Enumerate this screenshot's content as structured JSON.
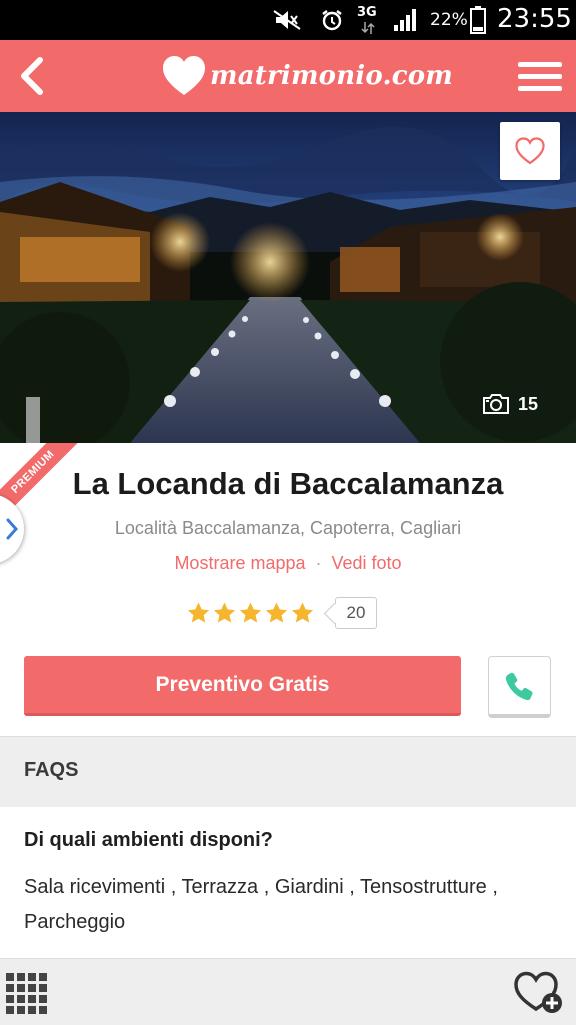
{
  "status_bar": {
    "network": "3G",
    "battery": "22%",
    "time": "23:55"
  },
  "header": {
    "logo_text": "matrimonio.com",
    "back_icon": "chevron-left-icon",
    "menu_icon": "hamburger-menu-icon"
  },
  "hero": {
    "photo_count": "15",
    "favorite_icon": "heart-outline-icon",
    "camera_icon": "camera-icon"
  },
  "venue": {
    "badge": "PREMIUM",
    "name": "La Locanda di Baccalamanza",
    "address": "Località Baccalamanza, Capoterra, Cagliari",
    "link_map": "Mostrare mappa",
    "link_separator": "·",
    "link_photos": "Vedi foto",
    "rating_stars": 5,
    "review_count": "20"
  },
  "actions": {
    "quote_label": "Preventivo Gratis",
    "call_icon": "phone-icon"
  },
  "faqs": {
    "header": "FAQS",
    "question": "Di quali ambienti disponi?",
    "answer": "Sala ricevimenti , Terrazza , Giardini , Tensostrutture , Parcheggio"
  },
  "colors": {
    "brand": "#f26a6a",
    "call_green": "#3ec9a0",
    "star": "#f6b52e"
  }
}
